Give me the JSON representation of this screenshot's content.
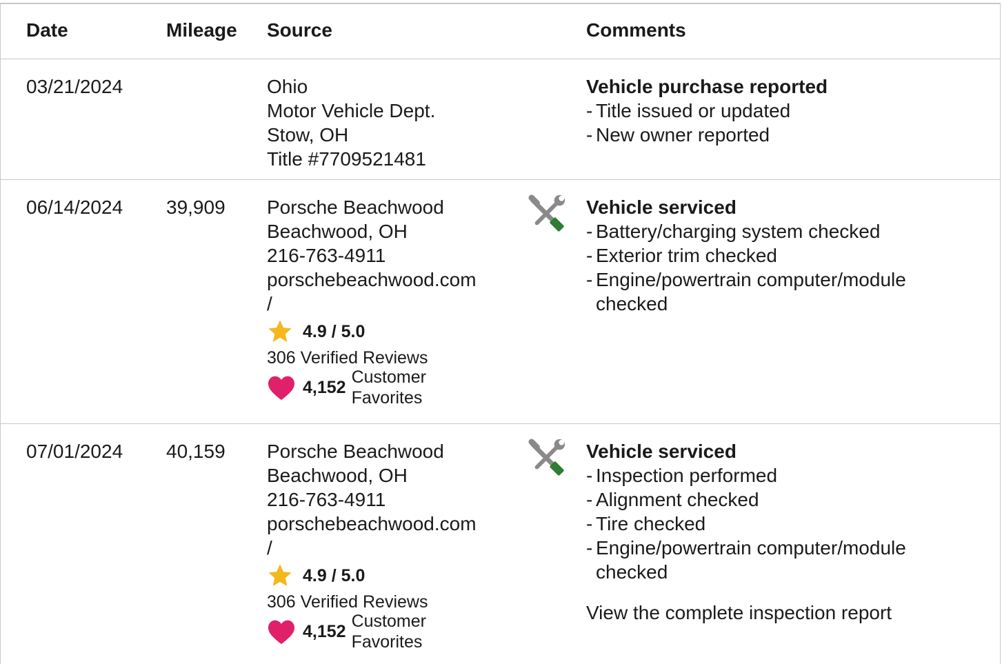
{
  "headers": {
    "date": "Date",
    "mileage": "Mileage",
    "source": "Source",
    "comments": "Comments"
  },
  "records": [
    {
      "date": "03/21/2024",
      "mileage": "",
      "source": [
        "Ohio",
        "Motor Vehicle Dept.",
        "Stow, OH",
        "Title #7709521481"
      ],
      "icon": "",
      "title": "Vehicle purchase reported",
      "items": [
        "Title issued or updated",
        "New owner reported"
      ]
    },
    {
      "date": "06/14/2024",
      "mileage": "39,909",
      "source": [
        "Porsche Beachwood",
        "Beachwood, OH",
        "216-763-4911",
        "porschebeachwood.com",
        "/"
      ],
      "rating": "4.9 / 5.0",
      "reviews": "306 Verified Reviews",
      "favorites_count": "4,152",
      "favorites_label_1": "Customer",
      "favorites_label_2": "Favorites",
      "icon": "service-tools-icon",
      "title": "Vehicle serviced",
      "items": [
        "Battery/charging system checked",
        "Exterior trim checked",
        "Engine/powertrain computer/module checked"
      ]
    },
    {
      "date": "07/01/2024",
      "mileage": "40,159",
      "source": [
        "Porsche Beachwood",
        "Beachwood, OH",
        "216-763-4911",
        "porschebeachwood.com",
        "/"
      ],
      "rating": "4.9 / 5.0",
      "reviews": "306 Verified Reviews",
      "favorites_count": "4,152",
      "favorites_label_1": "Customer",
      "favorites_label_2": "Favorites",
      "icon": "service-tools-icon",
      "title": "Vehicle serviced",
      "items": [
        "Inspection performed",
        "Alignment checked",
        "Tire checked",
        "Engine/powertrain computer/module checked"
      ],
      "link": "View the complete inspection report"
    }
  ],
  "bullet_char": "-",
  "colors": {
    "star": "#f4b81c",
    "heart": "#e0206a",
    "tool_gray": "#8a8a8a",
    "tool_green": "#2e7d32",
    "border": "#c8c8c8"
  }
}
